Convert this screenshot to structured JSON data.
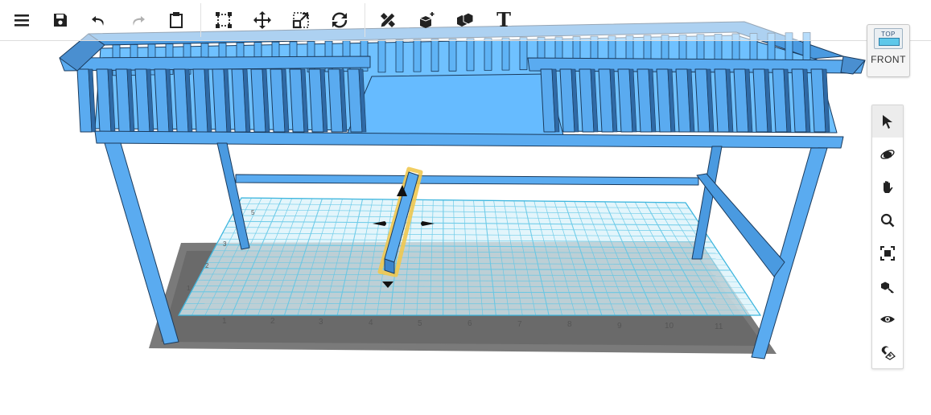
{
  "toolbar": {
    "menu": "menu-icon",
    "save": "save-icon",
    "undo": "undo-icon",
    "redo": "redo-icon",
    "clipboard": "clipboard-icon",
    "select_area": "select-area-icon",
    "move": "move-icon",
    "scale": "scale-icon",
    "rotate": "rotate-icon",
    "measure": "ruler-pencil-icon",
    "add_shape": "add-shape-icon",
    "boolean": "boolean-shapes-icon",
    "text_tool": "T"
  },
  "viewcube": {
    "top_label": "TOP",
    "front_label": "FRONT"
  },
  "grid": {
    "x_ticks": [
      "1",
      "2",
      "3",
      "4",
      "5",
      "6",
      "7",
      "8",
      "9",
      "10",
      "11"
    ],
    "y_ticks": [
      "1",
      "2",
      "3",
      "4",
      "5"
    ]
  },
  "side_toolbar": {
    "items": [
      "select-arrow-icon",
      "orbit-icon",
      "pan-hand-icon",
      "zoom-icon",
      "fit-view-icon",
      "workplane-icon",
      "visibility-eye-icon",
      "magnet-ruler-icon"
    ],
    "active": 0
  },
  "colors": {
    "model_blue": "#5aabf0",
    "model_edge": "#1a3a5c",
    "selection_outline": "#f0c850",
    "grid_line": "#5cc6e6",
    "shadow": "#6e6e6e"
  }
}
